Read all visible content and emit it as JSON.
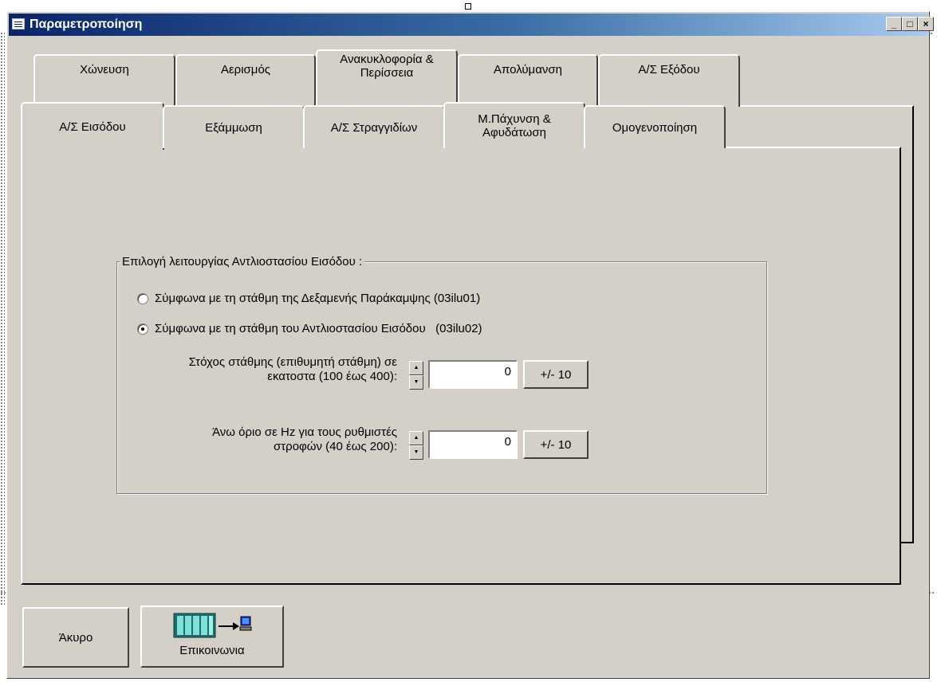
{
  "window": {
    "title": "Παραμετροποίηση",
    "minimize_label": "_",
    "maximize_label": "□",
    "close_label": "×"
  },
  "tabs": {
    "row_back": [
      "Χώνευση",
      "Αερισμός",
      "Ανακυκλοφορία &\nΠερίσσεια",
      "Απολύμανση",
      "Α/Σ Εξόδου"
    ],
    "row_front": [
      "Α/Σ Εισόδου",
      "Εξάμμωση",
      "Α/Σ Στραγγιδίων",
      "Μ.Πάχυνση &\nΑφυδάτωση",
      "Ομογενοποίηση"
    ],
    "active": "Α/Σ Εισόδου"
  },
  "group": {
    "legend": "Επιλογή λειτουργίας Αντλιοστασίου Εισόδου :",
    "radios": [
      {
        "label": "Σύμφωνα με τη στάθμη της Δεξαμενής Παράκαμψης (03ilu01)",
        "selected": false
      },
      {
        "label": "Σύμφωνα με τη στάθμη του Αντλιοστασίου Εισόδου   (03ilu02)",
        "selected": true
      }
    ],
    "fields": [
      {
        "label": "Στόχος στάθμης (επιθυμητή στάθμη) σε\nεκατοστα (100 έως 400):",
        "value": "0",
        "button": "+/- 10"
      },
      {
        "label": "Άνω όριο σε Hz για τους ρυθμιστές\nστροφών (40 έως 200):",
        "value": "0",
        "button": "+/- 10"
      }
    ]
  },
  "bottom": {
    "cancel": "Άκυρο",
    "communication": "Επικοινωνια",
    "comm_icon": "plc-to-computer-icon"
  },
  "colors": {
    "face": "#d4d0c8",
    "title_start": "#0a246a",
    "title_end": "#a6caf0"
  }
}
